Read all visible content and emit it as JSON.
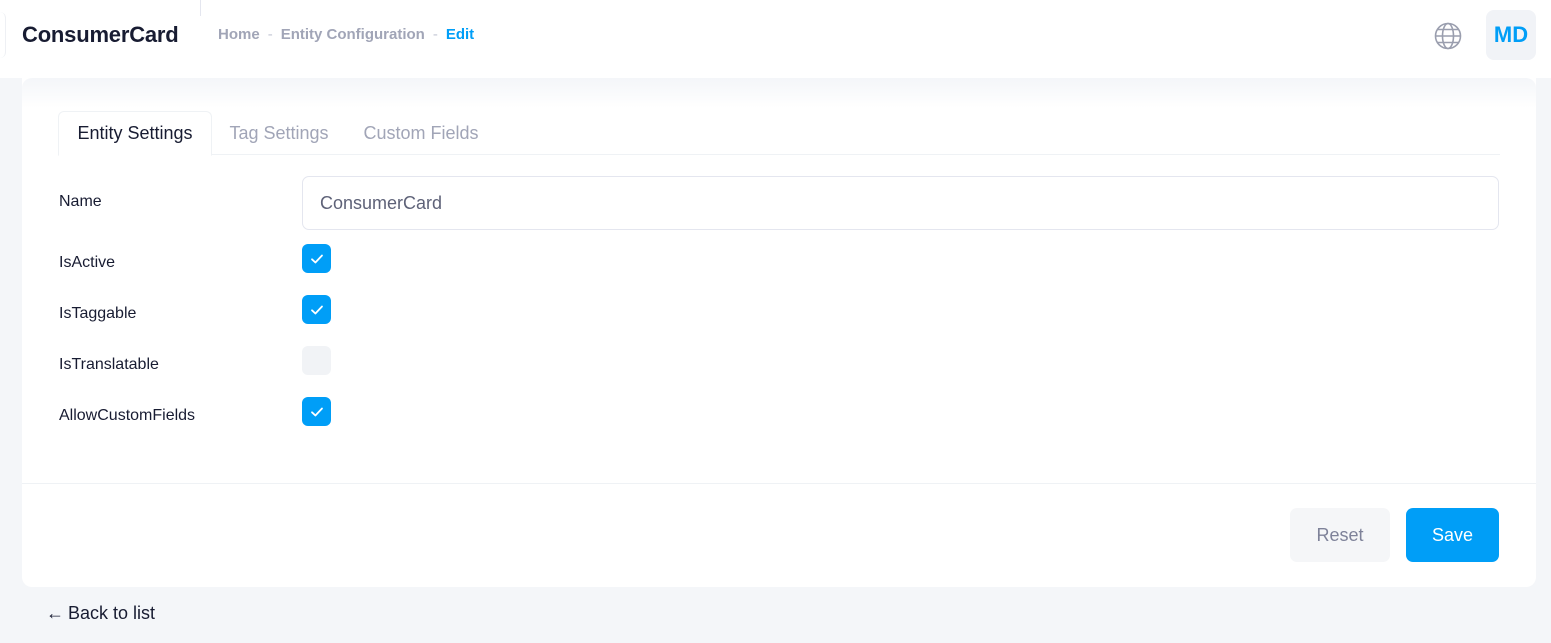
{
  "header": {
    "title": "ConsumerCard",
    "breadcrumb": [
      "Home",
      "Entity Configuration",
      "Edit"
    ],
    "breadcrumb_separator": "-",
    "language_icon": "globe-icon",
    "avatar_initials": "MD"
  },
  "tabs": [
    {
      "label": "Entity Settings",
      "active": true
    },
    {
      "label": "Tag Settings",
      "active": false
    },
    {
      "label": "Custom Fields",
      "active": false
    }
  ],
  "form": {
    "name_label": "Name",
    "name_value": "ConsumerCard",
    "fields": [
      {
        "label": "IsActive",
        "checked": true
      },
      {
        "label": "IsTaggable",
        "checked": true
      },
      {
        "label": "IsTranslatable",
        "checked": false
      },
      {
        "label": "AllowCustomFields",
        "checked": true
      }
    ]
  },
  "actions": {
    "reset_label": "Reset",
    "save_label": "Save"
  },
  "back_link": {
    "arrow": "←",
    "label": "Back to list"
  },
  "colors": {
    "accent": "#009ef7",
    "muted_text": "#a1a5b7",
    "background": "#f4f6f9"
  }
}
